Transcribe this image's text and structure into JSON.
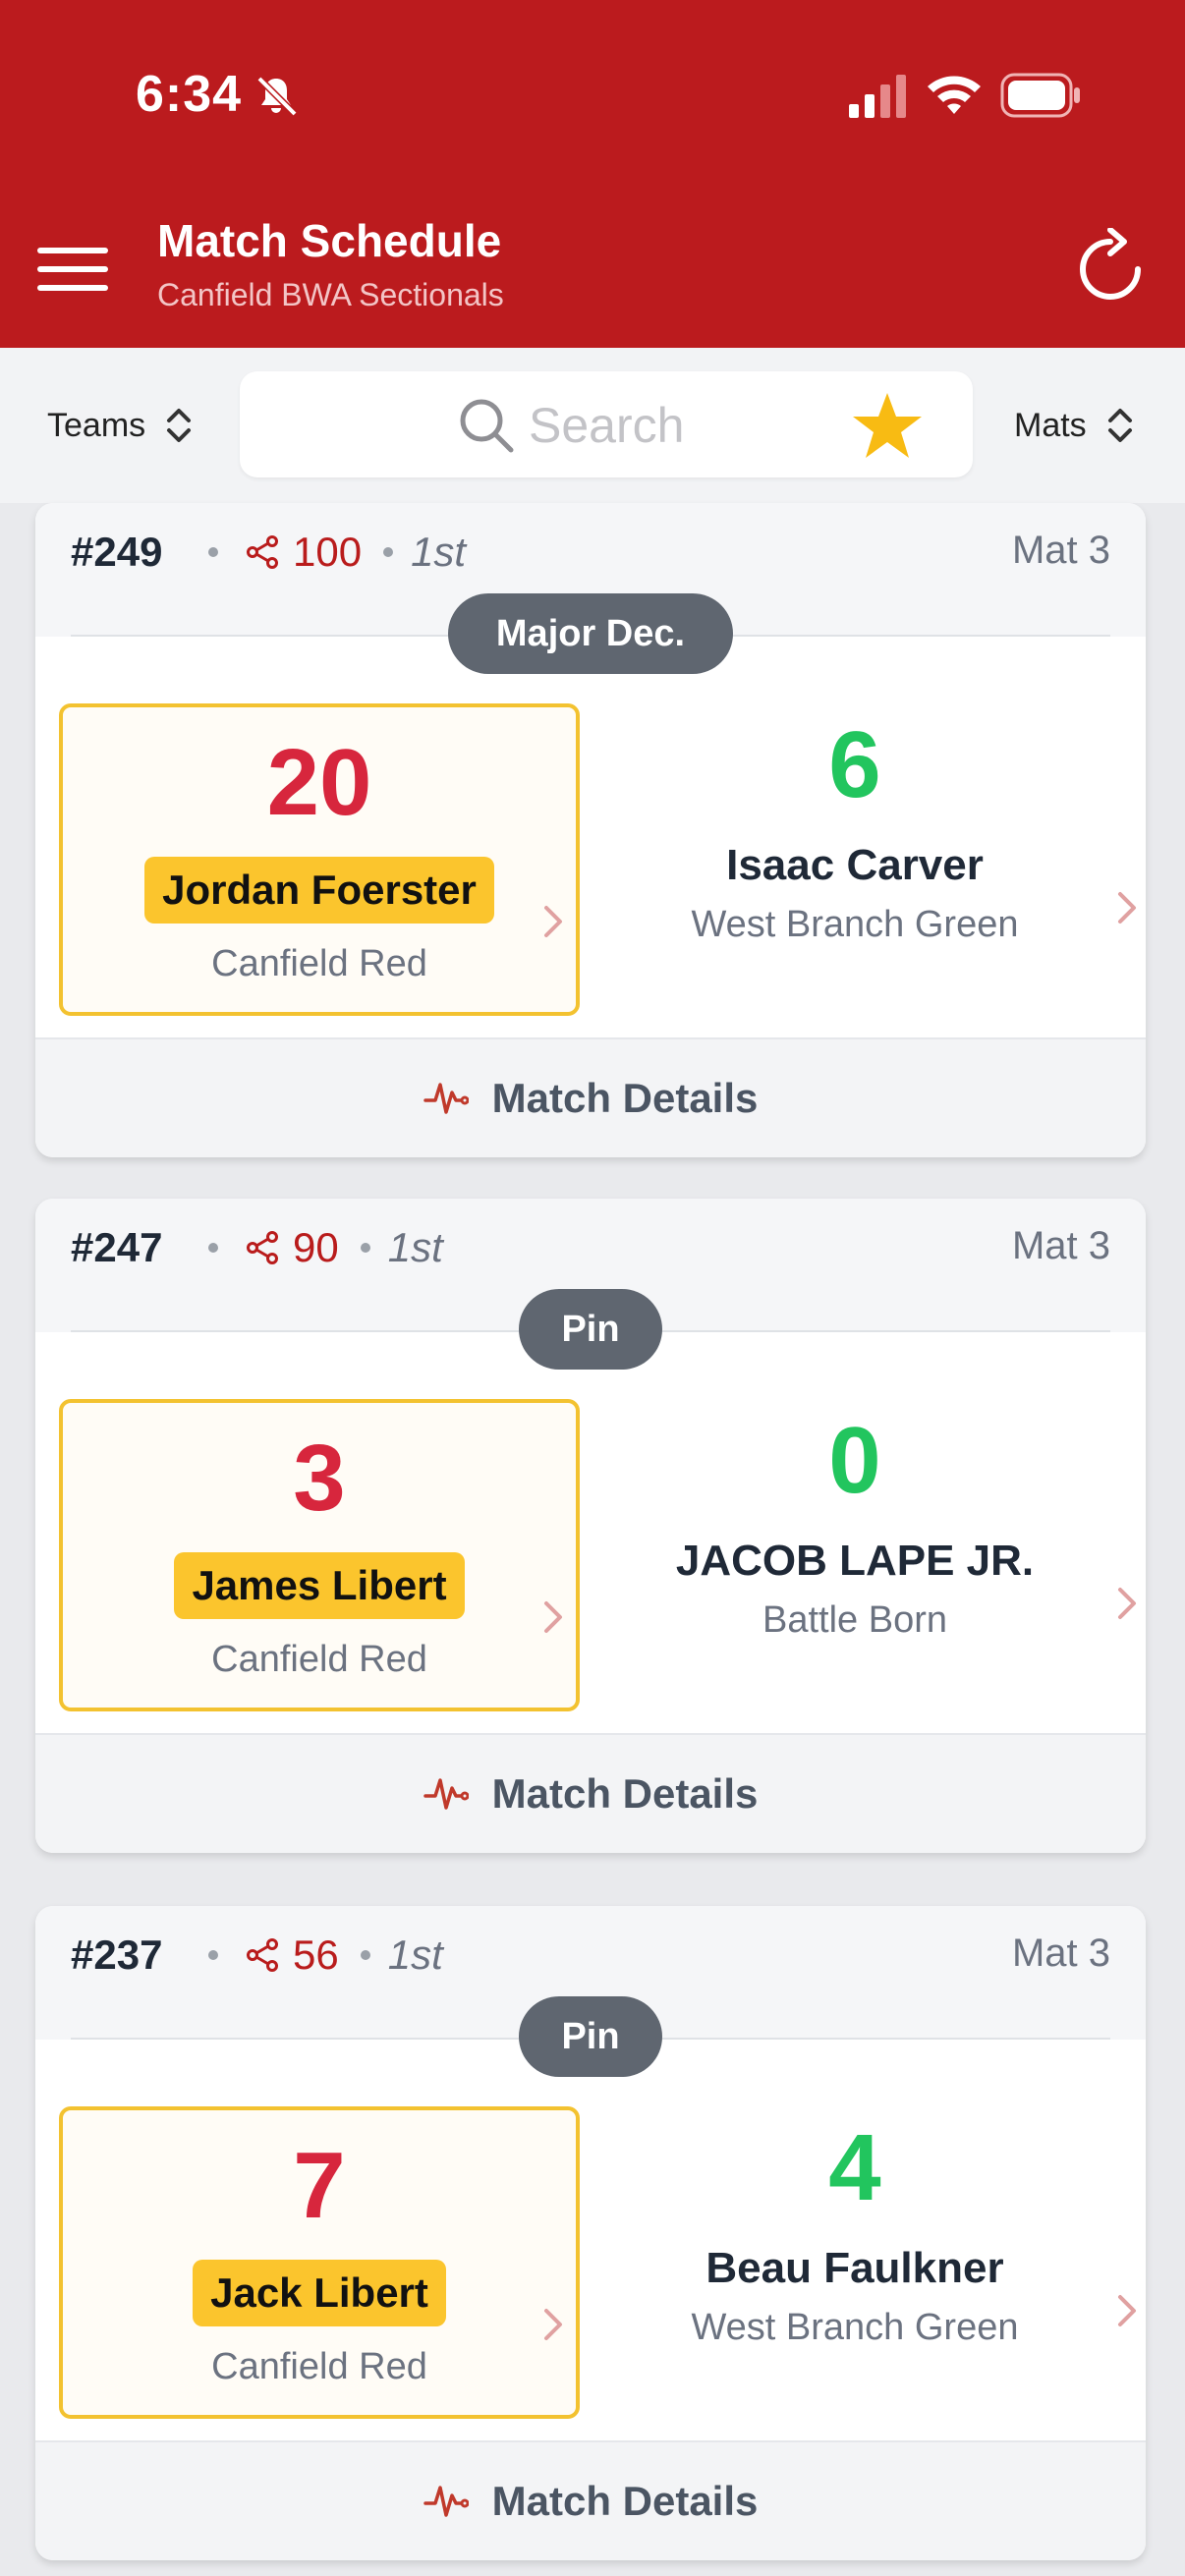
{
  "status_bar": {
    "time": "6:34"
  },
  "header": {
    "title": "Match Schedule",
    "subtitle": "Canfield BWA Sectionals"
  },
  "filters": {
    "teams_label": "Teams",
    "mats_label": "Mats",
    "search_placeholder": "Search"
  },
  "matches": [
    {
      "number": "#249",
      "bout": "100",
      "period": "1st",
      "mat": "Mat 3",
      "result": "Major Dec.",
      "winner": {
        "score": "20",
        "name": "Jordan Foerster",
        "team": "Canfield Red"
      },
      "loser": {
        "score": "6",
        "name": "Isaac Carver",
        "team": "West Branch Green"
      },
      "details_label": "Match Details"
    },
    {
      "number": "#247",
      "bout": "90",
      "period": "1st",
      "mat": "Mat 3",
      "result": "Pin",
      "winner": {
        "score": "3",
        "name": "James Libert",
        "team": "Canfield Red"
      },
      "loser": {
        "score": "0",
        "name": "JACOB LAPE JR.",
        "team": "Battle Born"
      },
      "details_label": "Match Details"
    },
    {
      "number": "#237",
      "bout": "56",
      "period": "1st",
      "mat": "Mat 3",
      "result": "Pin",
      "winner": {
        "score": "7",
        "name": "Jack Libert",
        "team": "Canfield Red"
      },
      "loser": {
        "score": "4",
        "name": "Beau Faulkner",
        "team": "West Branch Green"
      },
      "details_label": "Match Details"
    }
  ],
  "colors": {
    "header_red": "#bb1b1e",
    "winner_highlight": "#fbc52d",
    "winner_score": "#d7263d",
    "loser_score": "#22c55e",
    "star": "#f8bb13"
  }
}
